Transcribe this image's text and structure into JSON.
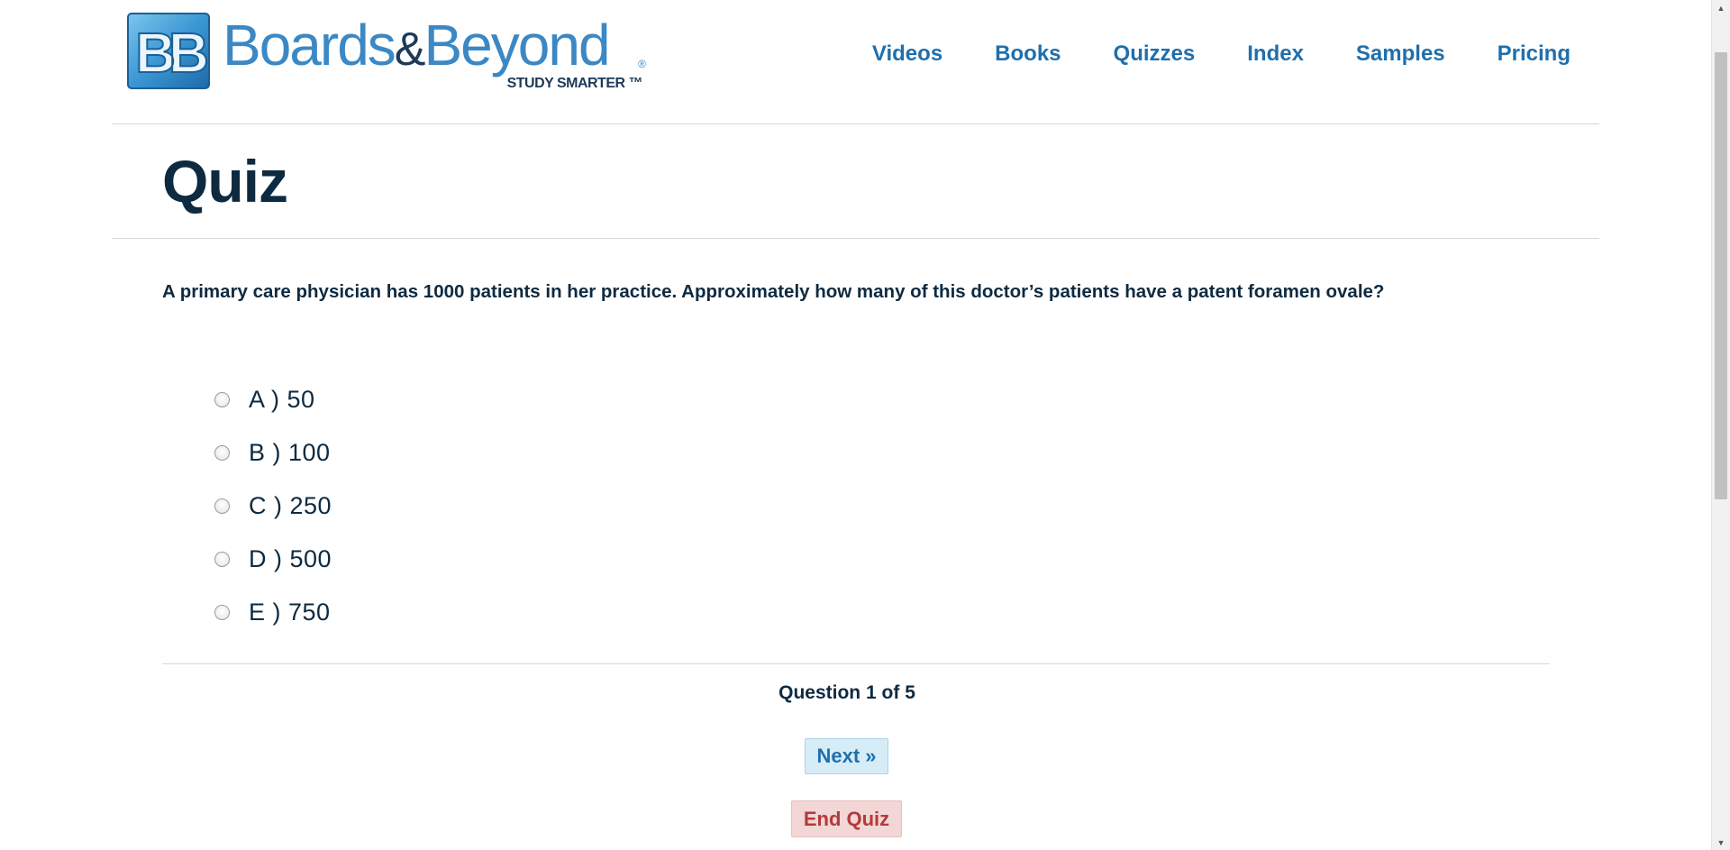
{
  "header": {
    "logo": {
      "mark": "BB",
      "word_left": "Boards",
      "amp": "&",
      "word_right": "Beyond",
      "registered": "®",
      "tagline": "STUDY SMARTER ™"
    },
    "nav": [
      "Videos",
      "Books",
      "Quizzes",
      "Index",
      "Samples",
      "Pricing"
    ]
  },
  "page_title": "Quiz",
  "question": {
    "text": "A primary care physician has 1000 patients in her practice. Approximately how many of this doctor’s patients have a patent foramen ovale?",
    "options": [
      "A ) 50",
      "B ) 100",
      "C ) 250",
      "D ) 500",
      "E ) 750"
    ]
  },
  "progress": {
    "prefix": "Question",
    "current": "1",
    "of": "of",
    "total": "5"
  },
  "buttons": {
    "next": "Next »",
    "end": "End Quiz"
  },
  "scrollbar": {
    "up": "▲",
    "down": "▼"
  },
  "colors": {
    "brand_blue": "#3b88c4",
    "nav_blue": "#1f6fad",
    "text_navy": "#0e2a40",
    "next_bg": "#d6edf8",
    "end_bg": "#f3d6d6",
    "end_text": "#b33a3a"
  }
}
